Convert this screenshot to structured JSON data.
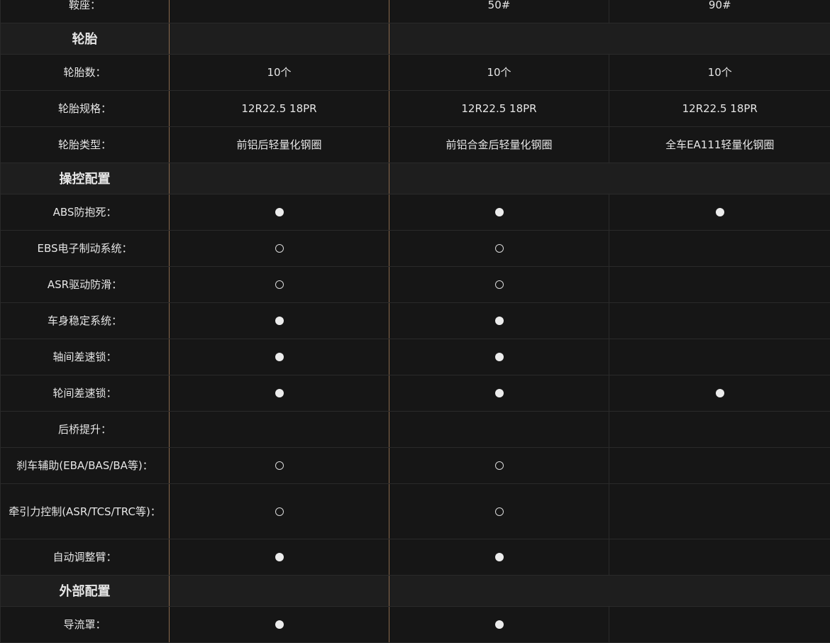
{
  "rows": [
    {
      "type": "row",
      "label": "鞍座：",
      "cells": [
        "",
        "50#",
        "90#"
      ],
      "h": 50
    },
    {
      "type": "section",
      "label": "轮胎",
      "h": 44
    },
    {
      "type": "row",
      "label": "轮胎数：",
      "cells": [
        "10个",
        "10个",
        "10个"
      ],
      "h": 51
    },
    {
      "type": "row",
      "label": "轮胎规格：",
      "cells": [
        "12R22.5 18PR",
        "12R22.5 18PR",
        "12R22.5 18PR"
      ],
      "h": 51
    },
    {
      "type": "row",
      "label": "轮胎类型：",
      "cells": [
        "前铝后轻量化钢圈",
        "前铝合金后轻量化钢圈",
        "全车EA111轻量化钢圈"
      ],
      "h": 51,
      "strongTop": true
    },
    {
      "type": "section",
      "label": "操控配置",
      "h": 44
    },
    {
      "type": "row",
      "label": "ABS防抱死：",
      "cells": [
        "●",
        "●",
        "●"
      ],
      "h": 51
    },
    {
      "type": "row",
      "label": "EBS电子制动系统：",
      "cells": [
        "○",
        "○",
        ""
      ],
      "h": 51
    },
    {
      "type": "row",
      "label": "ASR驱动防滑：",
      "cells": [
        "○",
        "○",
        ""
      ],
      "h": 51
    },
    {
      "type": "row",
      "label": "车身稳定系统：",
      "cells": [
        "●",
        "●",
        ""
      ],
      "h": 51
    },
    {
      "type": "row",
      "label": "轴间差速锁：",
      "cells": [
        "●",
        "●",
        ""
      ],
      "h": 51
    },
    {
      "type": "row",
      "label": "轮间差速锁：",
      "cells": [
        "●",
        "●",
        "●"
      ],
      "h": 51
    },
    {
      "type": "row",
      "label": "后桥提升：",
      "cells": [
        "",
        "",
        ""
      ],
      "h": 51
    },
    {
      "type": "row",
      "label": "刹车辅助(EBA/BAS/BA等)：",
      "cells": [
        "○",
        "○",
        ""
      ],
      "h": 51
    },
    {
      "type": "row",
      "label": "牵引力控制(ASR/TCS/TRC等)：",
      "cells": [
        "○",
        "○",
        ""
      ],
      "h": 78
    },
    {
      "type": "row",
      "label": "自动调整臂：",
      "cells": [
        "●",
        "●",
        ""
      ],
      "h": 51
    },
    {
      "type": "section",
      "label": "外部配置",
      "h": 44
    },
    {
      "type": "row",
      "label": "导流罩：",
      "cells": [
        "●",
        "●",
        ""
      ],
      "h": 51
    }
  ]
}
